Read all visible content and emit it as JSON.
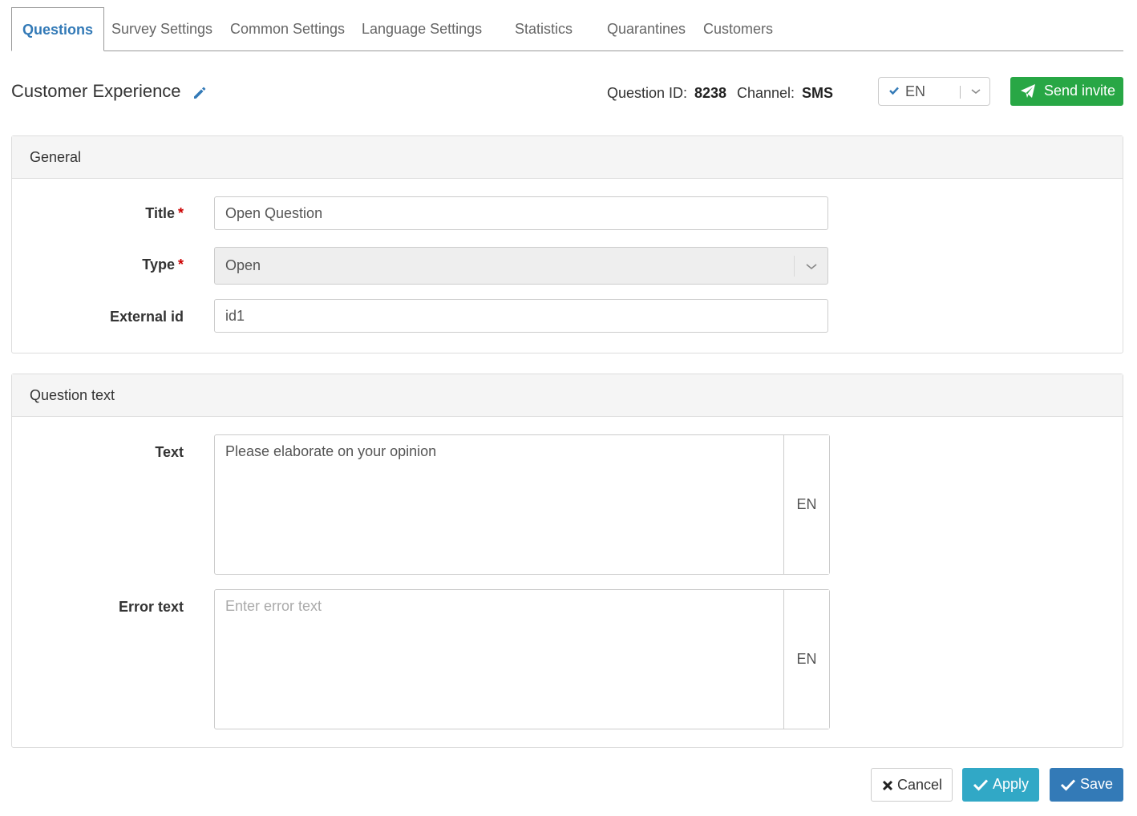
{
  "tabs": [
    {
      "label": "Questions",
      "active": true
    },
    {
      "label": "Survey Settings",
      "active": false
    },
    {
      "label": "Common Settings",
      "active": false
    },
    {
      "label": "Language Settings",
      "active": false
    },
    {
      "label": "Statistics",
      "active": false
    },
    {
      "label": "Quarantines",
      "active": false
    },
    {
      "label": "Customers",
      "active": false
    }
  ],
  "header": {
    "title": "Customer Experience",
    "question_id_label": "Question ID:",
    "question_id_value": "8238",
    "channel_label": "Channel:",
    "channel_value": "SMS",
    "language_selected": "EN",
    "send_invite_label": "Send invite"
  },
  "general": {
    "heading": "General",
    "title_label": "Title",
    "title_value": "Open Question",
    "type_label": "Type",
    "type_value": "Open",
    "external_id_label": "External id",
    "external_id_value": "id1",
    "required_mark": "*"
  },
  "question_text": {
    "heading": "Question text",
    "text_label": "Text",
    "text_value": "Please elaborate on your opinion",
    "text_lang": "EN",
    "error_label": "Error text",
    "error_placeholder": "Enter error text",
    "error_lang": "EN"
  },
  "footer": {
    "cancel_label": "Cancel",
    "apply_label": "Apply",
    "save_label": "Save"
  },
  "colors": {
    "accent": "#337ab7",
    "send_green": "#28a745",
    "apply_teal": "#31a8c6",
    "required_red": "#cc0000"
  },
  "icons": {
    "edit": "pencil-icon",
    "language_check": "check-icon",
    "send": "paper-plane-icon",
    "cancel": "times-icon",
    "apply": "check-icon",
    "save": "check-icon"
  }
}
